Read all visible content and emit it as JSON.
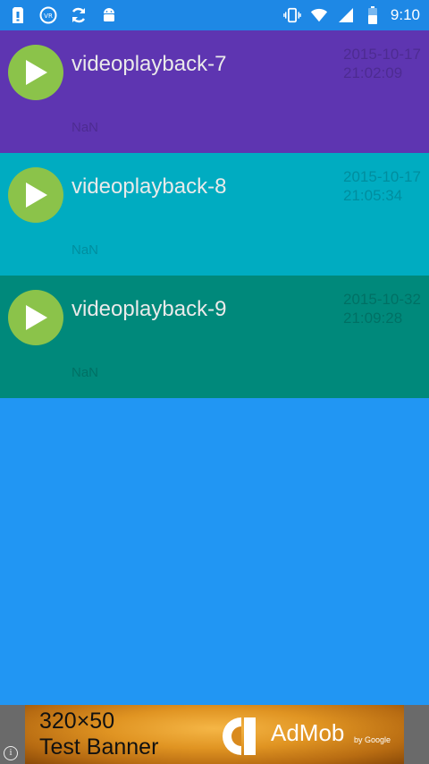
{
  "status_bar": {
    "time": "9:10",
    "left_icons": [
      "sd-card-icon",
      "vr-icon",
      "sync-icon",
      "android-icon"
    ],
    "right_icons": [
      "vibrate-icon",
      "wifi-icon",
      "cell-signal-icon",
      "battery-icon"
    ]
  },
  "videos": [
    {
      "title": "videoplayback-7",
      "date": "2015-10-17\n21:02:09",
      "duration": "NaN",
      "color": "#5e35b1"
    },
    {
      "title": "videoplayback-8",
      "date": "2015-10-17\n21:05:34",
      "duration": "NaN",
      "color": "#00acc1"
    },
    {
      "title": "videoplayback-9",
      "date": "2015-10-32\n21:09:28",
      "duration": "NaN",
      "color": "#00897b"
    }
  ],
  "background_color": "#2196f3",
  "ad": {
    "line1": "320×50",
    "line2": "Test Banner",
    "brand": "AdMob",
    "by": "by Google",
    "info": "i"
  }
}
